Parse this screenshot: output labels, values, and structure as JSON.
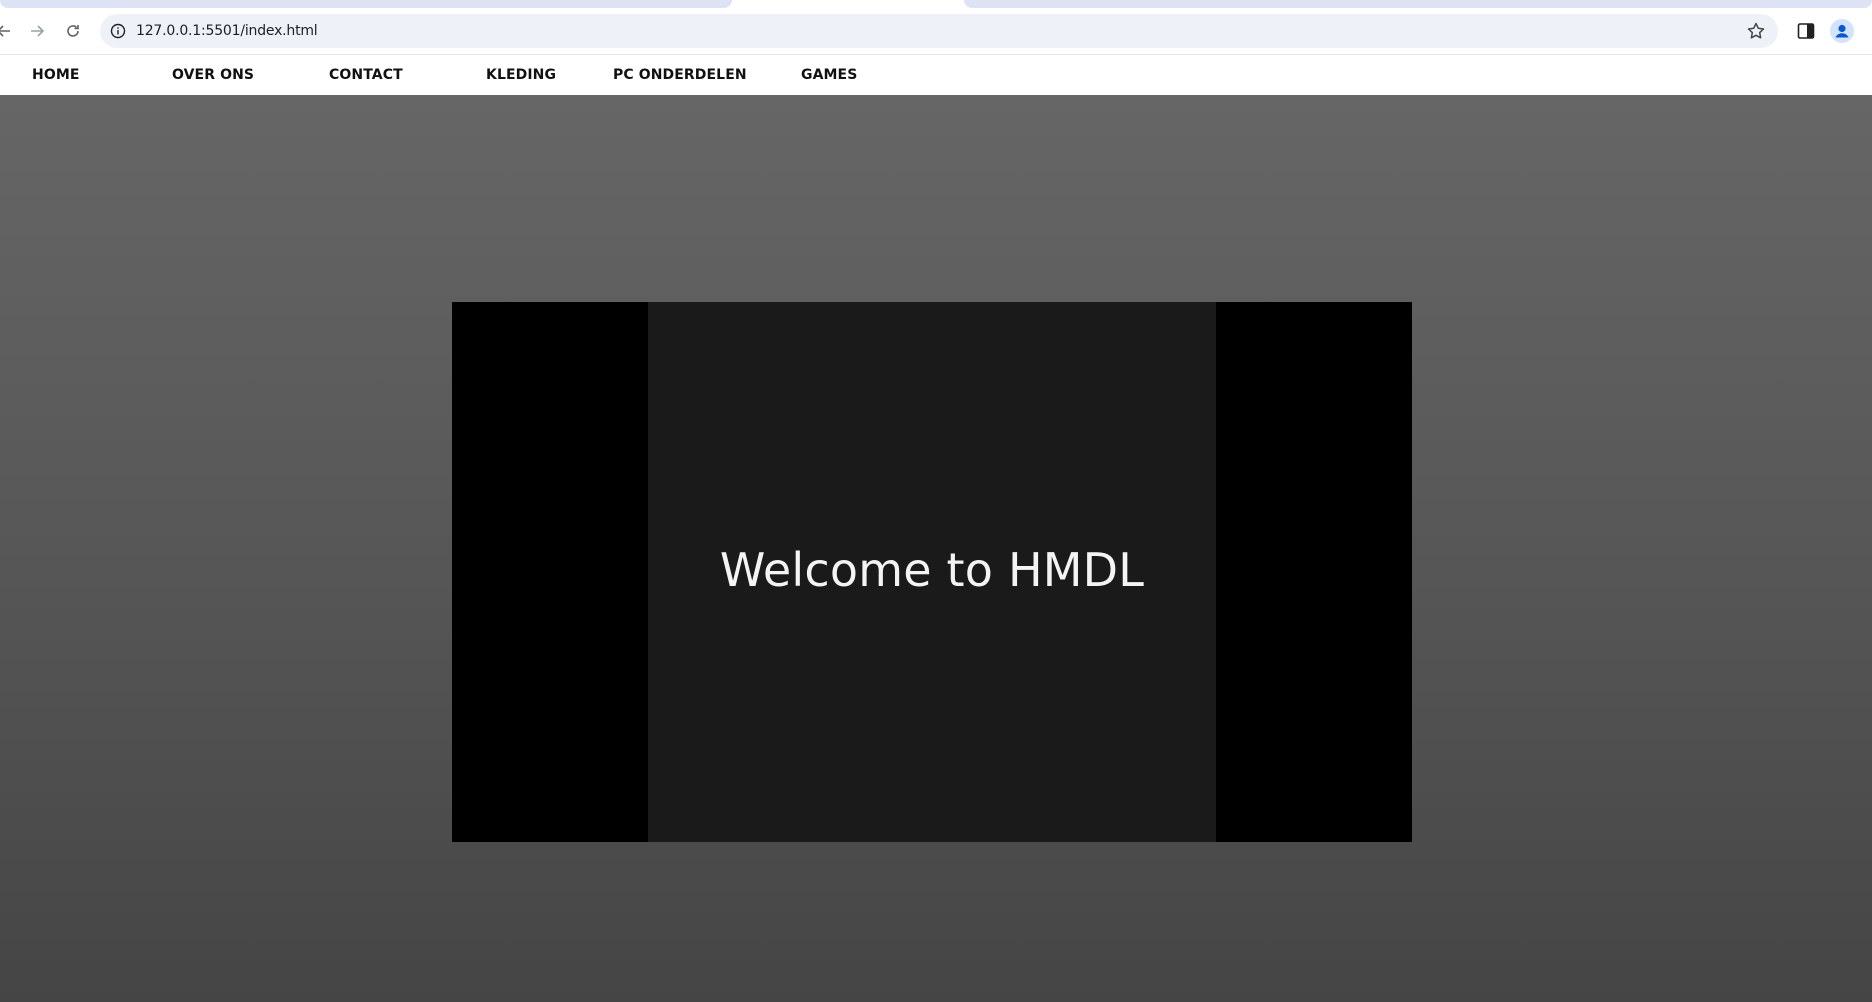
{
  "browser": {
    "url": "127.0.0.1:5501/index.html",
    "icons": {
      "back": "arrow-left-icon",
      "forward": "arrow-right-icon",
      "reload": "reload-icon",
      "site_info": "info-icon",
      "bookmark": "star-icon",
      "side_panel": "side-panel-icon",
      "profile": "profile-icon"
    }
  },
  "nav": {
    "items": [
      {
        "label": "HOME"
      },
      {
        "label": "OVER ONS"
      },
      {
        "label": "CONTACT"
      },
      {
        "label": "KLEDING"
      },
      {
        "label": "PC ONDERDELEN"
      },
      {
        "label": "GAMES"
      }
    ]
  },
  "hero": {
    "video_title": "Welcome to HMDL"
  },
  "colors": {
    "hero_top": "#666666",
    "hero_bottom": "#454545",
    "video_background": "#000000",
    "video_content": "#1b1a1b",
    "omnibox": "#eef1f8"
  }
}
